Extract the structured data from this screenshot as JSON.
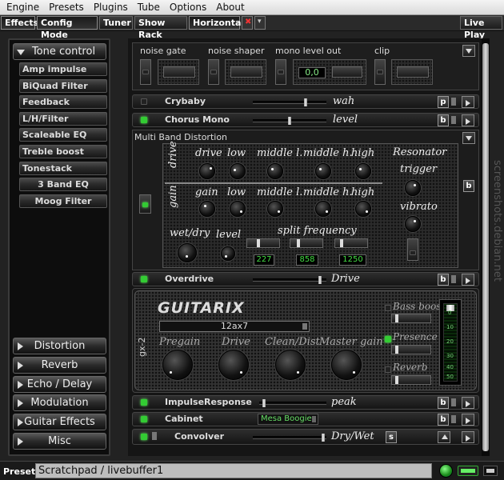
{
  "menubar": [
    "Engine",
    "Presets",
    "Plugins",
    "Tube",
    "Options",
    "About"
  ],
  "toolbar": {
    "effects": "Effects",
    "config_mode": "Config Mode",
    "tuner": "Tuner",
    "show_rack": "Show Rack",
    "horizontal": "Horizontal",
    "live_play": "Live Play"
  },
  "categories": {
    "tone_control": "Tone control",
    "distortion": "Distortion",
    "reverb": "Reverb",
    "echo_delay": "Echo / Delay",
    "modulation": "Modulation",
    "guitar_effects": "Guitar Effects",
    "misc": "Misc"
  },
  "plugins": [
    "Amp impulse",
    "BiQuad Filter",
    "Feedback",
    "L/H/Filter",
    "Scaleable EQ",
    "Treble boost",
    "Tonestack",
    "3 Band EQ",
    "Moog Filter"
  ],
  "topbox": {
    "noise_gate": "noise gate",
    "noise_shaper": "noise shaper",
    "mono_level_out": "mono level out",
    "mono_value": "0,0",
    "clip": "clip"
  },
  "crybaby": {
    "name": "Crybaby",
    "param": "wah",
    "btn": "p"
  },
  "chorus": {
    "name": "Chorus Mono",
    "param": "level",
    "btn": "b"
  },
  "mbd": {
    "title": "Multi Band Distortion",
    "drive": "drive",
    "gain": "gain",
    "cols": [
      "drive",
      "low",
      "middle l.",
      "middle h.",
      "high"
    ],
    "gaincols": [
      "gain",
      "low",
      "middle l.",
      "middle h.",
      "high"
    ],
    "resonator": "Resonator",
    "trigger": "trigger",
    "vibrato": "vibrato",
    "wetdry": "wet/dry",
    "level": "level",
    "split": "split frequency",
    "freqs": [
      "227",
      "858",
      "1250"
    ],
    "btn": "b"
  },
  "overdrive": {
    "name": "Overdrive",
    "param": "Drive",
    "btn": "b"
  },
  "amp": {
    "logo": "GUITARIX",
    "model": "12ax7",
    "side": "gx-2",
    "knobs": [
      "Pregain",
      "Drive",
      "Clean/Dist",
      "Master gain"
    ],
    "bass_boost": "Bass boost",
    "presence": "Presence",
    "reverb": "Reverb",
    "meter_ticks": [
      "0",
      "10",
      "20",
      "30",
      "40",
      "50"
    ]
  },
  "impulse": {
    "name": "ImpulseResponse",
    "param": "peak",
    "btn": "b"
  },
  "cabinet": {
    "name": "Cabinet",
    "value": "Mesa Boogie",
    "btn": "b"
  },
  "convolver": {
    "name": "Convolver",
    "param": "Dry/Wet",
    "btn": "s"
  },
  "preset": {
    "label": "Preset:",
    "value": "Scratchpad / livebuffer1"
  },
  "watermark": "screenshots.debian.net"
}
